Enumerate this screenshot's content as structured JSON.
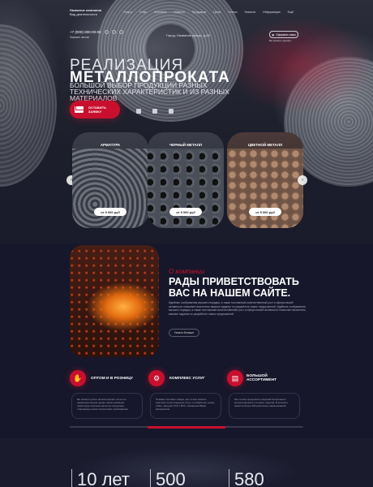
{
  "header": {
    "company_name": "Название компании",
    "company_desc": "Вид деятельности",
    "nav": [
      "Услуги",
      "О нас",
      "Контакты",
      "Новости",
      "Продукция",
      "Цены",
      "Статьи",
      "Новости",
      "Информация",
      "Ещё"
    ],
    "phone": "+7 (000) 000-00-00",
    "callback": "Заказать звонок",
    "address": "Город, Название улицы, д.00",
    "cart_label": "Оформить заказ",
    "cart_sub": "Вы можете сделать"
  },
  "hero": {
    "title_light": "РЕАЛИЗАЦИЯ",
    "title_bold": "МЕТАЛЛОПРОКАТА",
    "subtitle": "БОЛЬШОЙ ВЫБОР ПРОДУКЦИИ РАЗНЫХ ТЕХНИЧЕСКИХ ХАРАКТЕРИСТИК И ИЗ РАЗНЫХ МАТЕРИАЛОВ",
    "order_button": "ОСТАВИТЬ ЗАЯВКУ"
  },
  "products": [
    {
      "title": "АРМАТУРА",
      "price": "от 9 000 руб"
    },
    {
      "title": "ЧЕРНЫЙ МЕТАЛЛ",
      "price": "от 9 000 руб"
    },
    {
      "title": "ЦВЕТНОЙ МЕТАЛЛ",
      "price": "от 9 000 руб"
    }
  ],
  "about": {
    "subtitle": "О компании",
    "heading": "РАДЫ ПРИВЕТСТВОВАТЬ ВАС НА НАШЕМ САЙТЕ.",
    "text": "Идейные соображения высшего порядка, а также постоянный количественный рост и сфера нашей активности позволяет выполнять важные задания по разработке новых предложений. Идейные соображения высшего порядка, а также постоянный количественный рост и сфера нашей активности позволяет выполнять важные задания по разработке новых предложений.",
    "more_button": "Узнать больше"
  },
  "features": [
    {
      "title": "ОПТОМ И В РОЗНИЦУ",
      "text": "Вы можете купить металлопрокат оптом по привлекательным ценам. Наши компании гарантирует высокое качество продукции, отвечающее всем техническим требованиям."
    },
    {
      "title": "КОМПЛЕКС УСЛУГ",
      "text": "Помимо поставки товара, мы готовы оказать комплекс сопутствующих услуг по обработке, резке, гибке, нагрузке ГОУ и ВУС, оказанным Вами материалом."
    },
    {
      "title": "БОЛЬШОЙ АССОРТИМЕНТ",
      "text": "Мы готовы предложить широкий ассортимент металлопроката и готовых изделий. В каталоге имеется более 300 различных наименований."
    }
  ],
  "stats": [
    "10 лет",
    "500",
    "580"
  ],
  "colors": {
    "accent": "#c8102e",
    "background": "#16172a"
  }
}
